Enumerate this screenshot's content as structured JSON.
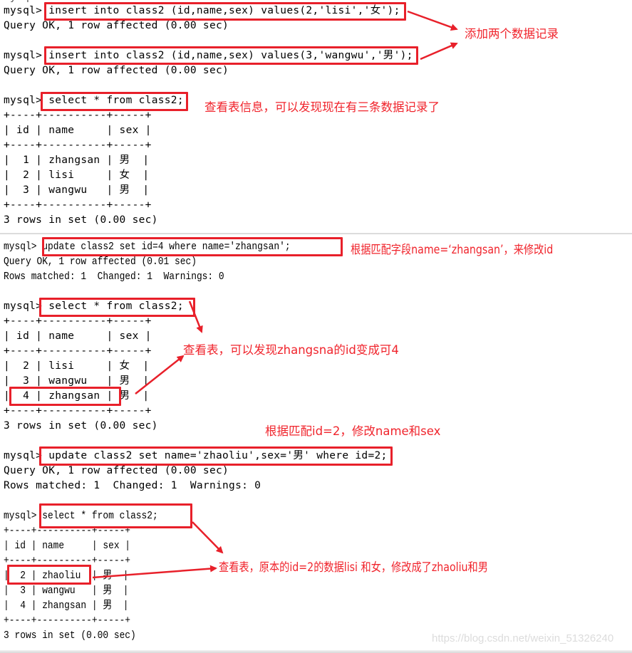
{
  "colors": {
    "annotation": "#f0242c",
    "terminal_text": "#000000",
    "background": "#ffffff"
  },
  "prompt": "mysql>",
  "block1": {
    "cmd1": "insert into class2 (id,name,sex) values(2,'lisi','女');",
    "res1": "Query OK, 1 row affected (0.00 sec)",
    "cmd2": "insert into class2 (id,name,sex) values(3,'wangwu','男');",
    "res2": "Query OK, 1 row affected (0.00 sec)",
    "note_insert": "添加两个数据记录",
    "cmd3": "select * from class2;",
    "note_select": "查看表信息，可以发现现在有三条数据记录了",
    "table": {
      "border": "+----+----------+-----+",
      "header": "| id | name     | sex |",
      "rows": [
        "|  1 | zhangsan | 男  |",
        "|  2 | lisi     | 女  |",
        "|  3 | wangwu   | 男  |"
      ]
    },
    "summary": "3 rows in set (0.00 sec)"
  },
  "block2": {
    "cmd1": "update class2 set id=4 where name='zhangsan';",
    "note_update1": "根据匹配字段name=‘zhangsan’，来修改id",
    "res1": "Query OK, 1 row affected (0.01 sec)",
    "res1b": "Rows matched: 1  Changed: 1  Warnings: 0",
    "cmd2": "select * from class2;",
    "note_select2": "查看表，可以发现zhangsna的id变成可4",
    "table": {
      "border": "+----+----------+-----+",
      "header": "| id | name     | sex |",
      "rows": [
        "|  2 | lisi     | 女  |",
        "|  3 | wangwu   | 男  |",
        "|  4 | zhangsan | 男  |"
      ]
    },
    "summary": "3 rows in set (0.00 sec)",
    "note_update2": "根据匹配id=2，修改name和sex",
    "cmd3": "update class2 set name='zhaoliu',sex='男' where id=2;",
    "res3": "Query OK, 1 row affected (0.00 sec)",
    "res3b": "Rows matched: 1  Changed: 1  Warnings: 0",
    "cmd4": "select * from class2;",
    "note_select3": "查看表，原本的id=2的数据lisi 和女，修改成了zhaoliu和男",
    "table2": {
      "border": "+----+----------+-----+",
      "header": "| id | name     | sex |",
      "rows": [
        "|  2 | zhaoliu  | 男  |",
        "|  3 | wangwu   | 男  |",
        "|  4 | zhangsan | 男  |"
      ]
    },
    "summary2": "3 rows in set (0.00 sec)"
  },
  "watermark": "https://blog.csdn.net/weixin_51326240"
}
